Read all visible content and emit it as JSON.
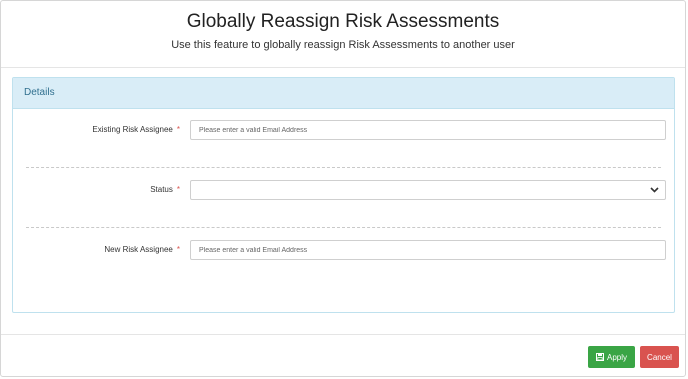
{
  "header": {
    "title": "Globally Reassign Risk Assessments",
    "subtitle": "Use this feature to globally reassign Risk Assessments to another user"
  },
  "panel": {
    "title": "Details",
    "fields": {
      "existing": {
        "label": "Existing Risk Assignee",
        "required_mark": "*",
        "value": "",
        "placeholder": "Please enter a valid Email Address"
      },
      "status": {
        "label": "Status",
        "required_mark": "*",
        "selected": ""
      },
      "new": {
        "label": "New Risk Assignee",
        "required_mark": "*",
        "value": "",
        "placeholder": "Please enter a valid Email Address"
      }
    }
  },
  "footer": {
    "apply_label": "Apply",
    "cancel_label": "Cancel",
    "apply_icon": "save-icon"
  },
  "colors": {
    "panel_header_bg": "#d9edf7",
    "panel_title": "#31708f",
    "apply": "#3aa545",
    "cancel": "#d9534f",
    "required": "#d9534f"
  }
}
